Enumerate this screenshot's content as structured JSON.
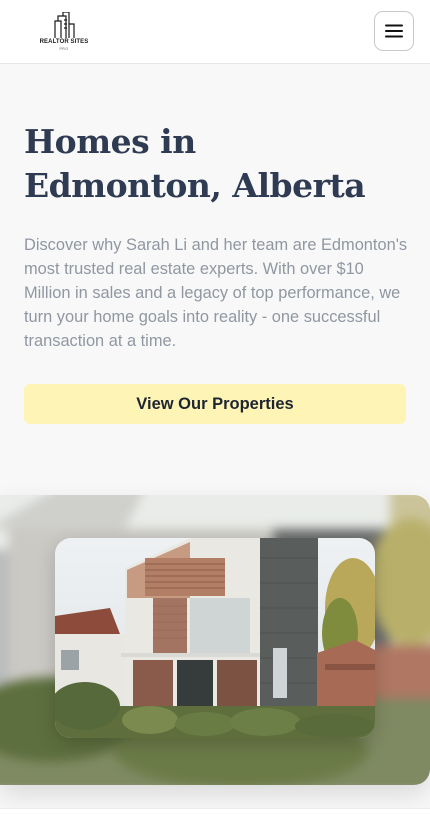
{
  "header": {
    "logo_text": "REALTOR SITES",
    "logo_sub": "PRO",
    "menu_icon": "hamburger-menu-icon"
  },
  "hero": {
    "title_line1": "Homes in",
    "title_line2": "Edmonton, Alberta",
    "description": "Discover why Sarah Li and her team are Edmonton's most trusted real estate experts. With over $10 Million in sales and a legacy of top performance, we turn your home goals into reality - one successful transaction at a time.",
    "cta_label": "View Our Properties"
  },
  "colors": {
    "cta_background": "#fdf4b6",
    "title": "#2f3b52",
    "description": "#9097a1"
  }
}
